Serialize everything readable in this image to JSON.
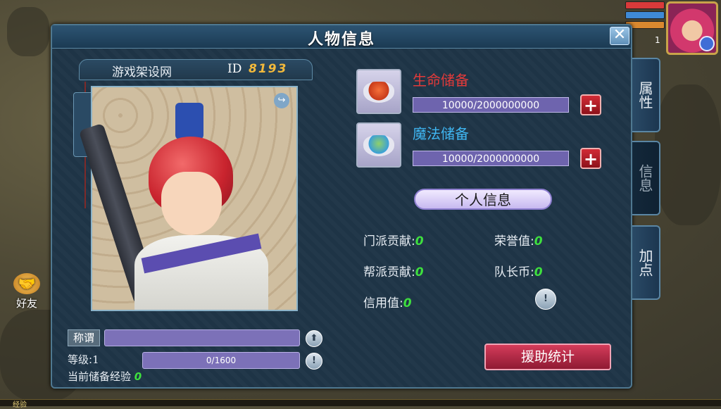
{
  "hud": {
    "level": "1",
    "bars": [
      "#d93a3a",
      "#3f8ad6",
      "#d9882f"
    ]
  },
  "friends_label": "好友",
  "bottom_exp_label": "经验",
  "panel": {
    "title": "人物信息",
    "close": "✕"
  },
  "profile": {
    "name": "游戏架设网",
    "id_label": "ID",
    "id_value": "8193",
    "share_icon": "↪"
  },
  "title_row": {
    "label": "称谓",
    "upload_icon": "⬆"
  },
  "level_row": {
    "label": "等级:",
    "value": "1",
    "exp": "0/1600",
    "info_icon": "!"
  },
  "stored_exp": {
    "label": "当前储备经验",
    "value": "0"
  },
  "reserves": {
    "hp": {
      "title": "生命储备",
      "value": "10000/2000000000",
      "color": "#e23a3a"
    },
    "mp": {
      "title": "魔法储备",
      "value": "10000/2000000000",
      "color": "#3fb6f2"
    },
    "plus": "+"
  },
  "personal_info_button": "个人信息",
  "stats": {
    "sect_contrib": {
      "label": "门派贡献:",
      "value": "0"
    },
    "honor": {
      "label": "荣誉值:",
      "value": "0"
    },
    "guild_contrib": {
      "label": "帮派贡献:",
      "value": "0"
    },
    "captain_coin": {
      "label": "队长币:",
      "value": "0"
    },
    "credit": {
      "label": "信用值:",
      "value": "0"
    },
    "info_icon": "!"
  },
  "assist_button": "援助统计",
  "side_tabs": [
    "属性",
    "信息",
    "加点"
  ]
}
